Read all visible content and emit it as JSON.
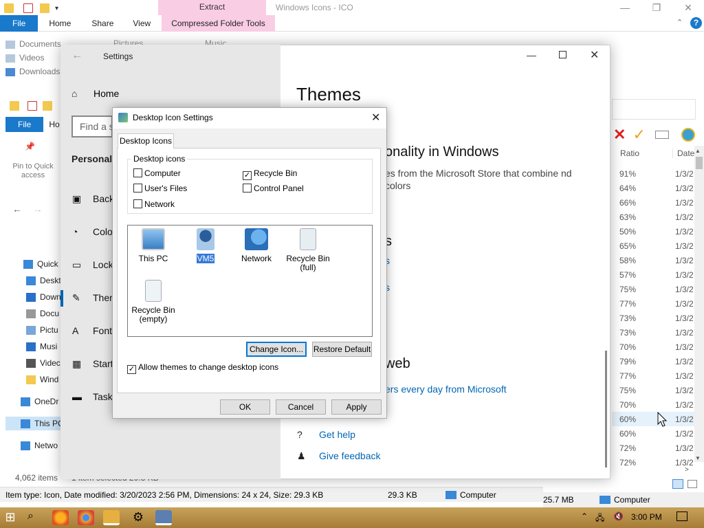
{
  "explorer": {
    "contextual_tab": "Extract",
    "title": "Windows Icons - ICO",
    "tabs": [
      "File",
      "Home",
      "Share",
      "View",
      "Compressed Folder Tools"
    ],
    "libraries": [
      "Documents",
      "Videos",
      "Downloads"
    ],
    "lib_extra": [
      "Pictures",
      "Music"
    ],
    "list_header": {
      "ratio": "Ratio",
      "date": "Date"
    },
    "ratios": [
      "91%",
      "64%",
      "66%",
      "63%",
      "50%",
      "65%",
      "58%",
      "57%",
      "75%",
      "77%",
      "73%",
      "73%",
      "70%",
      "79%",
      "77%",
      "75%",
      "70%",
      "60%",
      "60%",
      "72%",
      "72%"
    ],
    "date_prefix": "1/3/2"
  },
  "explorer2": {
    "file_tab": "File",
    "home_tab": "Ho",
    "pin_label": "Pin to Quick access",
    "nav": [
      "Quick",
      "Deskt",
      "Down",
      "Docu",
      "Pictu",
      "Musi",
      "Videc",
      "Wind",
      "OneDr",
      "This PC",
      "Netwo"
    ],
    "items_count": "4,062 items",
    "selection": "1 item selected  29.3 KB"
  },
  "status": {
    "text": "Item type: Icon, Date modified: 3/20/2023 2:56 PM, Dimensions: 24 x 24, Size: 29.3 KB",
    "size": "29.3 KB",
    "location": "Computer",
    "size2": "25.7 MB",
    "location2": "Computer"
  },
  "settings": {
    "window_title": "Settings",
    "home": "Home",
    "search_placeholder": "Find a s",
    "section": "Personaliz",
    "menu": [
      "Back",
      "Colo",
      "Lock",
      "Them",
      "Fonts",
      "Start",
      "Task"
    ],
    "page_title": "Themes",
    "h_personality": "onality in Windows",
    "desc": "es from the Microsoft Store that combine nd colors",
    "h_s": "s",
    "link_s": "s",
    "link_s2": "s",
    "h_web": "web",
    "web_link": "ers every day from Microsoft",
    "get_help": "Get help",
    "give_feedback": "Give feedback"
  },
  "dialog": {
    "title": "Desktop Icon Settings",
    "tab": "Desktop Icons",
    "group": "Desktop icons",
    "checkboxes": [
      {
        "label": "Computer",
        "checked": false
      },
      {
        "label": "Recycle Bin",
        "checked": true
      },
      {
        "label": "User's Files",
        "checked": false
      },
      {
        "label": "Control Panel",
        "checked": false
      },
      {
        "label": "Network",
        "checked": false
      }
    ],
    "icons": [
      "This PC",
      "VM5",
      "Network",
      "Recycle Bin (full)",
      "Recycle Bin (empty)"
    ],
    "change_icon": "Change Icon...",
    "restore_default": "Restore Default",
    "allow_themes": "Allow themes to change desktop icons",
    "ok": "OK",
    "cancel": "Cancel",
    "apply": "Apply"
  },
  "taskbar": {
    "time": "3:00 PM"
  },
  "colors": {
    "accent": "#1979ca",
    "extract_tab": "#f9cde4",
    "taskbar": "#b89048",
    "link": "#0066b4"
  }
}
